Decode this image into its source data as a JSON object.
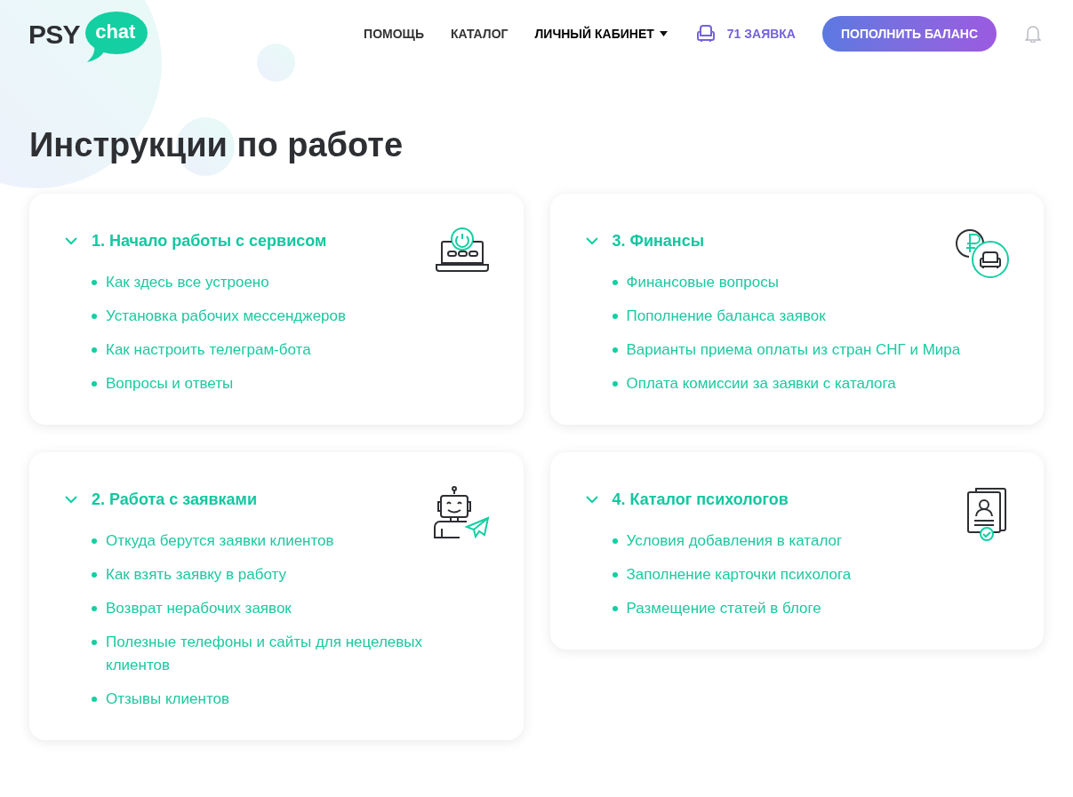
{
  "header": {
    "logo": {
      "left": "PSY",
      "bubble": "chat"
    },
    "nav": [
      {
        "label": "ПОМОЩЬ",
        "dropdown": false
      },
      {
        "label": "КАТАЛОГ",
        "dropdown": false
      },
      {
        "label": "ЛИЧНЫЙ КАБИНЕТ",
        "dropdown": true
      }
    ],
    "requests": "71 ЗАЯВКА",
    "topup_button": "ПОПОЛНИТЬ БАЛАНС"
  },
  "title": "Инструкции по работе",
  "sections": [
    {
      "title": "1. Начало работы с сервисом",
      "kind": "laptop",
      "expanded": true,
      "links": [
        "Как здесь все устроено",
        "Установка рабочих мессенджеров",
        "Как настроить телеграм-бота",
        "Вопросы и ответы"
      ]
    },
    {
      "title": "3. Финансы",
      "kind": "finance",
      "expanded": true,
      "links": [
        "Финансовые вопросы",
        "Пополнение баланса заявок",
        "Варианты приема оплаты из стран СНГ и Мира",
        "Оплата комиссии за заявки с каталога"
      ]
    },
    {
      "title": "2. Работа с заявками",
      "kind": "robot",
      "expanded": true,
      "links": [
        "Откуда берутся заявки клиентов",
        "Как взять заявку в работу",
        "Возврат нерабочих заявок",
        "Полезные телефоны и сайты для нецелевых клиентов",
        "Отзывы клиентов"
      ]
    },
    {
      "title": "4. Каталог психологов",
      "kind": "catalog",
      "expanded": true,
      "links": [
        "Условия добавления в каталог",
        "Заполнение карточки психолога",
        "Размещение статей в блоге"
      ]
    }
  ]
}
